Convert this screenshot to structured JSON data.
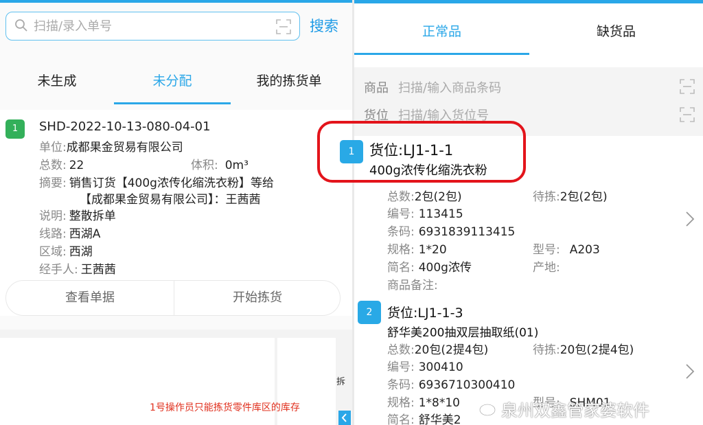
{
  "left": {
    "search": {
      "placeholder": "扫描/录入单号",
      "button_label": "搜索"
    },
    "tabs": [
      {
        "label": "未生成",
        "active": false
      },
      {
        "label": "未分配",
        "active": true
      },
      {
        "label": "我的拣货单",
        "active": false
      }
    ],
    "order": {
      "index": "1",
      "order_no": "SHD-2022-10-13-080-04-01",
      "unit_label": "单位:",
      "unit": "成都果金贸易有限公司",
      "count_label": "总数:",
      "count": "22",
      "volume_label": "体积:",
      "volume": "0m³",
      "summary_label": "摘要:",
      "summary_line1": "销售订货【400g浓传化缩洗衣粉】等给",
      "summary_line2": "【成都果金贸易有限公司】：王茜茜",
      "note_label": "说明:",
      "note": "整散拆单",
      "route_label": "线路:",
      "route": "西湖A",
      "area_label": "区域:",
      "area": "西湖",
      "handler_label": "经手人:",
      "handler": "王茜茜",
      "actions": {
        "view": "查看单据",
        "start": "开始拣货"
      }
    },
    "operator_note": "1号操作员只能拣货零件库区的库存",
    "partial_text": "拆"
  },
  "right": {
    "tabs": [
      {
        "label": "正常品",
        "active": true
      },
      {
        "label": "缺货品",
        "active": false
      }
    ],
    "filters": {
      "product_label": "商品",
      "product_placeholder": "扫描/输入商品条码",
      "location_label": "货位",
      "location_placeholder": "扫描/输入货位号"
    },
    "items": [
      {
        "index": "1",
        "location": "货位:LJ1-1-1",
        "name": "400g浓传化缩洗衣粉",
        "total_label": "总数:",
        "total": "2包(2包)",
        "pending_label": "待拣:",
        "pending": "2包(2包)",
        "code_label": "编号:",
        "code": "113415",
        "barcode_label": "条码:",
        "barcode": "6931839113415",
        "spec_label": "规格:",
        "spec": "1*20",
        "model_label": "型号:",
        "model": "A203",
        "short_label": "简名:",
        "short_name": "400g浓传",
        "origin_label": "产地:",
        "origin": "",
        "remark_label": "商品备注:",
        "remark": ""
      },
      {
        "index": "2",
        "location": "货位:LJ1-1-3",
        "name": "舒华美200抽双层抽取纸(01)",
        "total_label": "总数:",
        "total": "20包(2提4包)",
        "pending_label": "待拣:",
        "pending": "20包(2提4包)",
        "code_label": "编号:",
        "code": "300410",
        "barcode_label": "条码:",
        "barcode": "6936710300410",
        "spec_label": "规格:",
        "spec": "1*8*10",
        "model_label": "型号:",
        "model": "SHM01",
        "short_label": "简名:",
        "short_name": "舒华美2"
      }
    ]
  },
  "watermark": "泉州双鑫管家婆软件",
  "colors": {
    "accent": "#2aa7e8",
    "badge_green": "#33b05a",
    "highlight_red": "#e3141b",
    "note_red": "#e0301e"
  }
}
